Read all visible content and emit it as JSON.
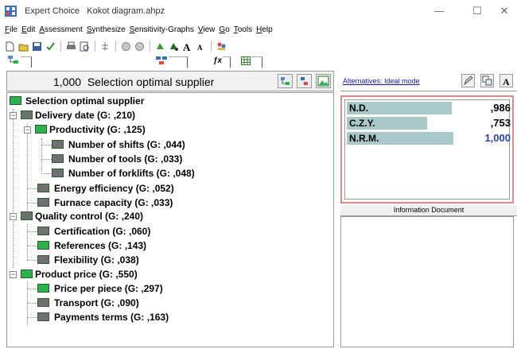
{
  "window": {
    "title": "Expert Choice   Kokot diagram.ahpz",
    "minimize": "—",
    "maximize": "☐",
    "close": "✕"
  },
  "menu": [
    "File",
    "Edit",
    "Assessment",
    "Synthesize",
    "Sensitivity-Graphs",
    "View",
    "Go",
    "Tools",
    "Help"
  ],
  "left_header": {
    "title": "1,000  Selection optimal supplier"
  },
  "tree": {
    "root": "Selection optimal supplier",
    "nodes": [
      {
        "label": "Delivery date (G: ,210)"
      },
      {
        "label": "Productivity (G: ,125)"
      },
      {
        "label": "Number of shifts (G: ,044)"
      },
      {
        "label": "Number of tools (G: ,033)"
      },
      {
        "label": "Number of forklifts (G: ,048)"
      },
      {
        "label": "Energy efficiency (G: ,052)"
      },
      {
        "label": "Furnace capacity (G: ,033)"
      },
      {
        "label": "Quality control (G: ,240)"
      },
      {
        "label": "Certification (G: ,060)"
      },
      {
        "label": "References (G: ,143)"
      },
      {
        "label": "Flexibility (G: ,038)"
      },
      {
        "label": "Product price (G: ,550)"
      },
      {
        "label": "Price per piece (G: ,297)"
      },
      {
        "label": "Transport (G: ,090)"
      },
      {
        "label": "Payments terms (G: ,163)"
      }
    ]
  },
  "alternatives": {
    "link": "Alternatives: Ideal mode",
    "items": [
      {
        "name": "N.D.",
        "value": ",986",
        "score": 0.986
      },
      {
        "name": "C.Z.Y.",
        "value": ",753",
        "score": 0.753
      },
      {
        "name": "N.R.M.",
        "value": "1,000",
        "score": 1.0
      }
    ]
  },
  "info": {
    "header": "Information Document"
  },
  "colors": {
    "node_green": "#2bb24c",
    "node_gray": "#707070",
    "bar": "#a9c9c9",
    "best_value": "#2a3fb4",
    "results_border": "#d98c8c",
    "link": "#1a1aa6"
  },
  "toolbar_icons": [
    "new-icon",
    "open-icon",
    "save-icon",
    "check-icon",
    "print-icon",
    "preview-icon",
    "tree-icon",
    "model-icon",
    "chart-icon",
    "synth-icon",
    "nodes-icon",
    "font-bigger-icon",
    "font-smaller-icon",
    "people-icon"
  ]
}
